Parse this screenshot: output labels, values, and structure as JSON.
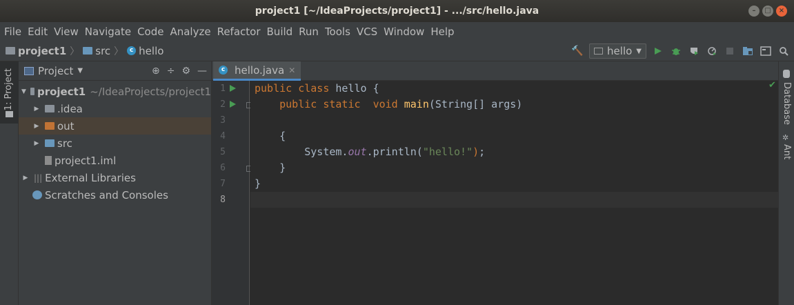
{
  "window": {
    "title": "project1 [~/IdeaProjects/project1] - .../src/hello.java",
    "buttons": [
      "–",
      "□",
      "×"
    ]
  },
  "menu": [
    "File",
    "Edit",
    "View",
    "Navigate",
    "Code",
    "Analyze",
    "Refactor",
    "Build",
    "Run",
    "Tools",
    "VCS",
    "Window",
    "Help"
  ],
  "breadcrumb": {
    "project": "project1",
    "folder": "src",
    "file": "hello"
  },
  "toolbar": {
    "run_config": "hello",
    "icons": [
      "hammer-icon",
      "run-icon",
      "debug-icon",
      "coverage-icon",
      "profile-icon",
      "stop-icon",
      "project-structure-icon",
      "terminal-icon",
      "search-icon"
    ]
  },
  "left_stripe": {
    "project_tab": "1: Project"
  },
  "project_panel": {
    "title": "Project",
    "tree": [
      {
        "label": "project1",
        "suffix": "~/IdeaProjects/project1",
        "level": 0,
        "expanded": true,
        "type": "module"
      },
      {
        "label": ".idea",
        "level": 1,
        "expanded": false,
        "type": "folder"
      },
      {
        "label": "out",
        "level": 1,
        "expanded": false,
        "type": "folder-excluded",
        "selected": true
      },
      {
        "label": "src",
        "level": 1,
        "expanded": false,
        "type": "folder-source"
      },
      {
        "label": "project1.iml",
        "level": 1,
        "type": "file"
      },
      {
        "label": "External Libraries",
        "level": 0,
        "expanded": false,
        "type": "libraries"
      },
      {
        "label": "Scratches and Consoles",
        "level": 0,
        "type": "scratches"
      }
    ]
  },
  "editor": {
    "tab": "hello.java",
    "line_numbers": [
      "1",
      "2",
      "3",
      "4",
      "5",
      "6",
      "7",
      "8"
    ],
    "current_line": 8
  },
  "right_stripe": {
    "database": "Database",
    "ant": "Ant"
  },
  "colors": {
    "keyword": "#cc7832",
    "method": "#ffc66d",
    "string": "#6a8759",
    "field": "#9876aa",
    "accent": "#4a88c7"
  }
}
